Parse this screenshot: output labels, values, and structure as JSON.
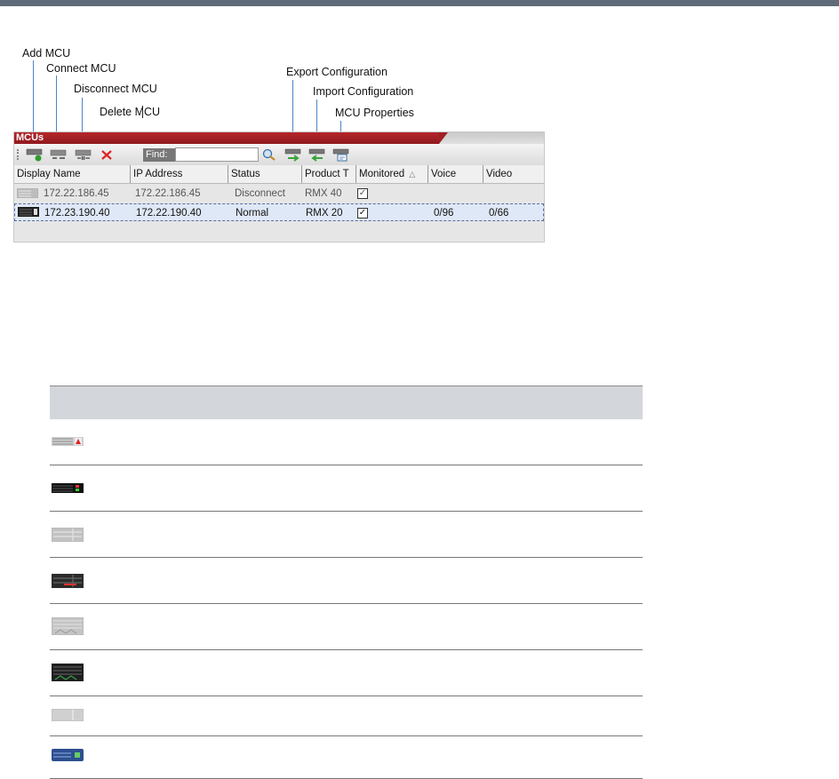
{
  "callouts": {
    "add_mcu": "Add MCU",
    "connect_mcu": "Connect MCU",
    "disconnect_mcu": "Disconnect MCU",
    "delete_mcu": "Delete MCU",
    "export_configuration": "Export Configuration",
    "import_configuration": "Import Configuration",
    "mcu_properties": "MCU Properties"
  },
  "panel": {
    "title": "MCUs",
    "find_label": "Find:",
    "find_value": "",
    "columns": [
      "Display Name",
      "IP Address",
      "Status",
      "Product T",
      "Monitored",
      "Voice",
      "Video"
    ],
    "rows": [
      {
        "display_name": "172.22.186.45",
        "ip": "172.22.186.45",
        "status": "Disconnect",
        "product": "RMX 40",
        "monitored": true,
        "voice": "",
        "video": "",
        "selected": false
      },
      {
        "display_name": "172.23.190.40",
        "ip": "172.22.190.40",
        "status": "Normal",
        "product": "RMX 20",
        "monitored": true,
        "voice": "0/96",
        "video": "0/66",
        "selected": true
      }
    ]
  },
  "legend": {
    "icons": [
      "mcu-disconnected-red-icon",
      "mcu-connected-black-icon",
      "rmx2000-disconnected-icon",
      "rmx2000-connected-icon",
      "rmx4000-disconnected-icon",
      "rmx4000-connected-icon",
      "rmx1500-disconnected-icon",
      "rmx1500-connected-icon"
    ]
  },
  "colors": {
    "panel_tab": "#a02024",
    "selection": "#dfe8f6",
    "legend_header": "#d3d6da",
    "callout_line": "#4a86c8"
  }
}
